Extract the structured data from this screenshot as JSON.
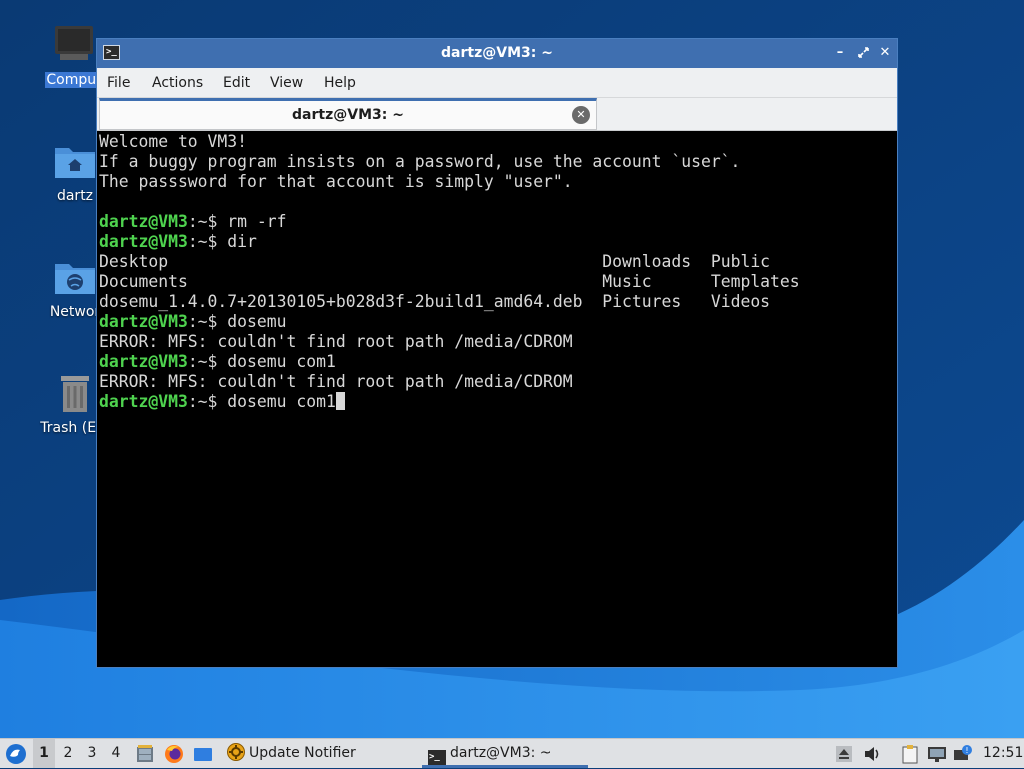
{
  "desktop": {
    "icons": [
      {
        "label": "Comput",
        "icon": "computer-icon"
      },
      {
        "label": "dartz",
        "icon": "home-folder-icon"
      },
      {
        "label": "Networ",
        "icon": "network-folder-icon"
      },
      {
        "label": "Trash (Em",
        "icon": "trash-icon"
      }
    ]
  },
  "window": {
    "title": "dartz@VM3: ~",
    "menu": [
      "File",
      "Actions",
      "Edit",
      "View",
      "Help"
    ],
    "tab_label": "dartz@VM3: ~"
  },
  "terminal": {
    "prompt_user": "dartz@VM3",
    "prompt_tail": ":~$ ",
    "lines": [
      {
        "type": "out",
        "text": "Welcome to VM3!"
      },
      {
        "type": "out",
        "text": "If a buggy program insists on a password, use the account `user`."
      },
      {
        "type": "out",
        "text": "The passsword for that account is simply \"user\"."
      },
      {
        "type": "out",
        "text": ""
      },
      {
        "type": "cmd",
        "text": "rm -rf"
      },
      {
        "type": "cmd",
        "text": "dir"
      },
      {
        "type": "dir",
        "cols": [
          "Desktop",
          "Downloads",
          "Public"
        ]
      },
      {
        "type": "dir",
        "cols": [
          "Documents",
          "Music",
          "Templates"
        ]
      },
      {
        "type": "dir",
        "cols": [
          "dosemu_1.4.0.7+20130105+b028d3f-2build1_amd64.deb",
          "Pictures",
          "Videos"
        ]
      },
      {
        "type": "cmd",
        "text": "dosemu"
      },
      {
        "type": "out",
        "text": "ERROR: MFS: couldn't find root path /media/CDROM"
      },
      {
        "type": "cmd",
        "text": "dosemu com1"
      },
      {
        "type": "out",
        "text": "ERROR: MFS: couldn't find root path /media/CDROM"
      },
      {
        "type": "cmd",
        "text": "dosemu com1",
        "cursor": true
      }
    ]
  },
  "taskbar": {
    "workspaces": [
      "1",
      "2",
      "3",
      "4"
    ],
    "active_workspace": "1",
    "tasks": [
      {
        "label": "Update Notifier",
        "icon": "update-notifier-icon"
      },
      {
        "label": "dartz@VM3: ~",
        "icon": "terminal-icon"
      }
    ],
    "clock": "12:51"
  },
  "colors": {
    "prompt": "#4fd34f",
    "titlebar": "#3f6fb0",
    "wallpaper_dark": "#0b3d78",
    "wallpaper_light": "#2a8ce6"
  }
}
